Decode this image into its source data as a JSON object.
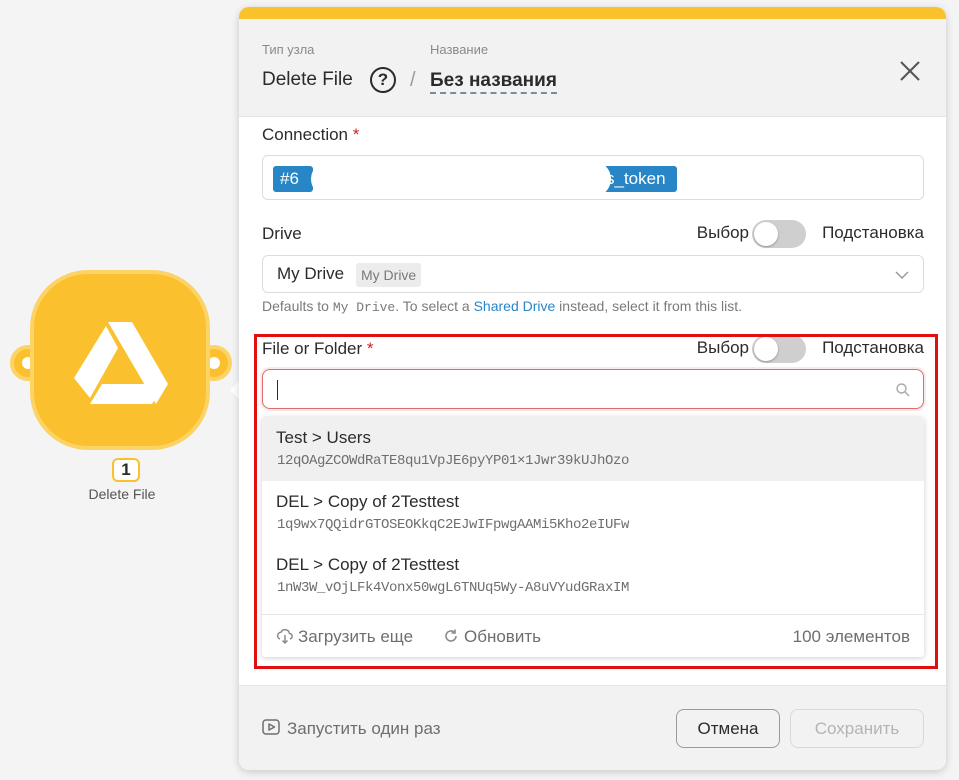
{
  "node": {
    "badge": "1",
    "caption": "Delete File",
    "icon": "google-drive-icon",
    "color": "#fbc02d"
  },
  "header": {
    "type_label": "Тип узла",
    "type_value": "Delete File",
    "help_icon": "?",
    "separator": "/",
    "name_label": "Название",
    "name_value": "Без названия",
    "accent_color": "#f9c22b"
  },
  "connection": {
    "label": "Connection",
    "required": "*",
    "chip_start": "#6",
    "chip_end": "s_token"
  },
  "drive": {
    "label": "Drive",
    "toggle_left": "Выбор",
    "toggle_right": "Подстановка",
    "value": "My Drive",
    "tag": "My Drive",
    "hint_prefix": "Defaults to ",
    "hint_code": "My Drive",
    "hint_mid": ". To select a ",
    "hint_link": "Shared Drive",
    "hint_suffix": " instead, select it from this list."
  },
  "file": {
    "label": "File or Folder",
    "required": "*",
    "toggle_left": "Выбор",
    "toggle_right": "Подстановка",
    "search_value": ""
  },
  "dropdown": {
    "items": [
      {
        "title": "Test > Users",
        "id": "12qOAgZCOWdRaTE8qu1VpJE6pyYP01×1Jwr39kUJhOzo"
      },
      {
        "title": "DEL > Copy of 2Testtest",
        "id": "1q9wx7QQidrGTOSEOKkqC2EJwIFpwgAAMi5Kho2eIUFw"
      },
      {
        "title": "DEL > Copy of 2Testtest",
        "id": "1nW3W_vOjLFk4Vonx50wgL6TNUq5Wy-A8uVYudGRaxIM"
      }
    ],
    "load_more": "Загрузить еще",
    "refresh": "Обновить",
    "count": "100 элементов"
  },
  "footer": {
    "run_once": "Запустить один раз",
    "cancel": "Отмена",
    "save": "Сохранить"
  },
  "colors": {
    "link": "#2886c6",
    "required": "#d61f1f",
    "highlight": "#e10f0f"
  }
}
